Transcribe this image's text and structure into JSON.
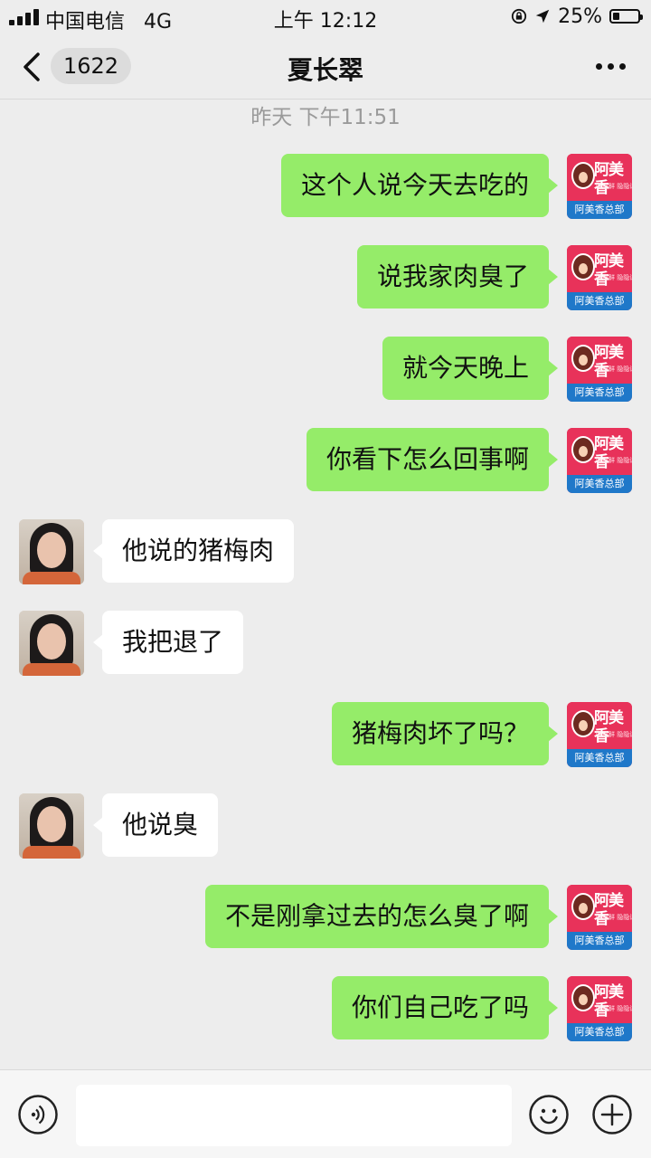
{
  "status_bar": {
    "carrier": "中国电信",
    "network": "4G",
    "time": "上午 12:12",
    "battery": "25%",
    "battery_level": 0.25
  },
  "header": {
    "back_icon": "chevron-left-icon",
    "unread_count": "1622",
    "title": "夏长翠",
    "more_icon": "ellipsis-icon"
  },
  "chat": {
    "timestamp": "昨天 下午11:51",
    "messages": [
      {
        "side": "right",
        "text": "这个人说今天去吃的"
      },
      {
        "side": "right",
        "text": "说我家肉臭了"
      },
      {
        "side": "right",
        "text": "就今天晚上"
      },
      {
        "side": "right",
        "text": "你看下怎么回事啊"
      },
      {
        "side": "left",
        "text": "他说的猪梅肉"
      },
      {
        "side": "left",
        "text": "我把退了"
      },
      {
        "side": "right",
        "text": "猪梅肉坏了吗？"
      },
      {
        "side": "left",
        "text": "他说臭"
      },
      {
        "side": "right",
        "text": "不是刚拿过去的怎么臭了啊"
      },
      {
        "side": "right",
        "text": "你们自己吃了吗"
      }
    ],
    "self_avatar": {
      "logo_text": "阿美香",
      "logo_sub": "味道鲜 隐隐诱月",
      "brand_name": "阿美香总部"
    }
  },
  "input_bar": {
    "voice_icon": "voice-icon",
    "text_value": "",
    "emoji_icon": "emoji-icon",
    "plus_icon": "plus-icon"
  }
}
